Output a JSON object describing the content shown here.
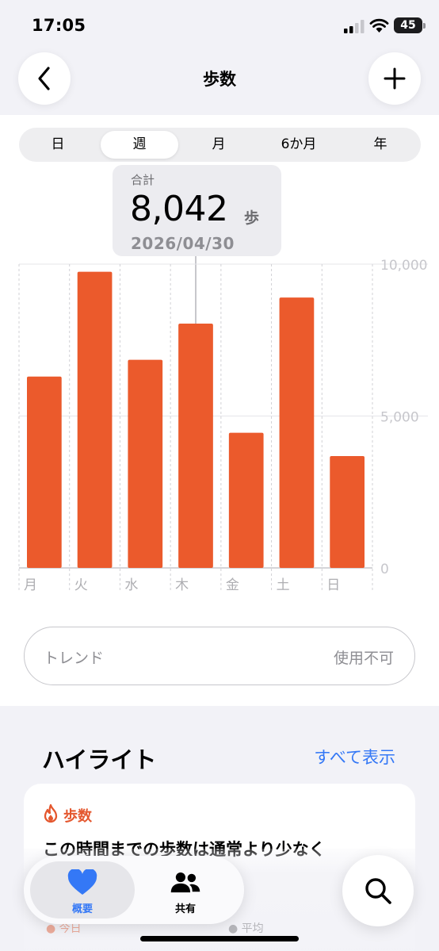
{
  "status_bar": {
    "time": "17:05",
    "battery": "45"
  },
  "nav": {
    "title": "歩数",
    "back_icon": "chevron-left-icon",
    "add_icon": "plus-icon"
  },
  "segments": [
    {
      "label": "日",
      "selected": false
    },
    {
      "label": "週",
      "selected": true
    },
    {
      "label": "月",
      "selected": false
    },
    {
      "label": "6か月",
      "selected": false
    },
    {
      "label": "年",
      "selected": false
    }
  ],
  "tooltip": {
    "label": "合計",
    "value": "8,042",
    "unit": "歩",
    "date": "2026/04/30"
  },
  "chart_data": {
    "type": "bar",
    "categories": [
      "月",
      "火",
      "水",
      "木",
      "金",
      "土",
      "日"
    ],
    "values": [
      6300,
      9750,
      6850,
      8042,
      4450,
      8900,
      3680
    ],
    "ylim": [
      0,
      10000
    ],
    "yticks": [
      "10,000",
      "5,000",
      "0"
    ],
    "highlighted_index": 3,
    "color": "#eb5a2c",
    "grid": true
  },
  "trend": {
    "label": "トレンド",
    "value": "使用不可"
  },
  "highlights": {
    "header": "ハイライト",
    "see_all": "すべて表示",
    "card_title": "歩数",
    "card_text": "この時間までの歩数は通常より少なく",
    "legend_today": "● 今日",
    "legend_avg": "● 平均"
  },
  "tab_bar": {
    "items": [
      {
        "label": "概要",
        "icon": "heart-icon",
        "active": true
      },
      {
        "label": "共有",
        "icon": "people-icon",
        "active": false
      }
    ],
    "search_icon": "search-icon"
  },
  "colors": {
    "accent": "#eb5a2c",
    "link": "#3478f6",
    "background": "#f2f2f7"
  }
}
